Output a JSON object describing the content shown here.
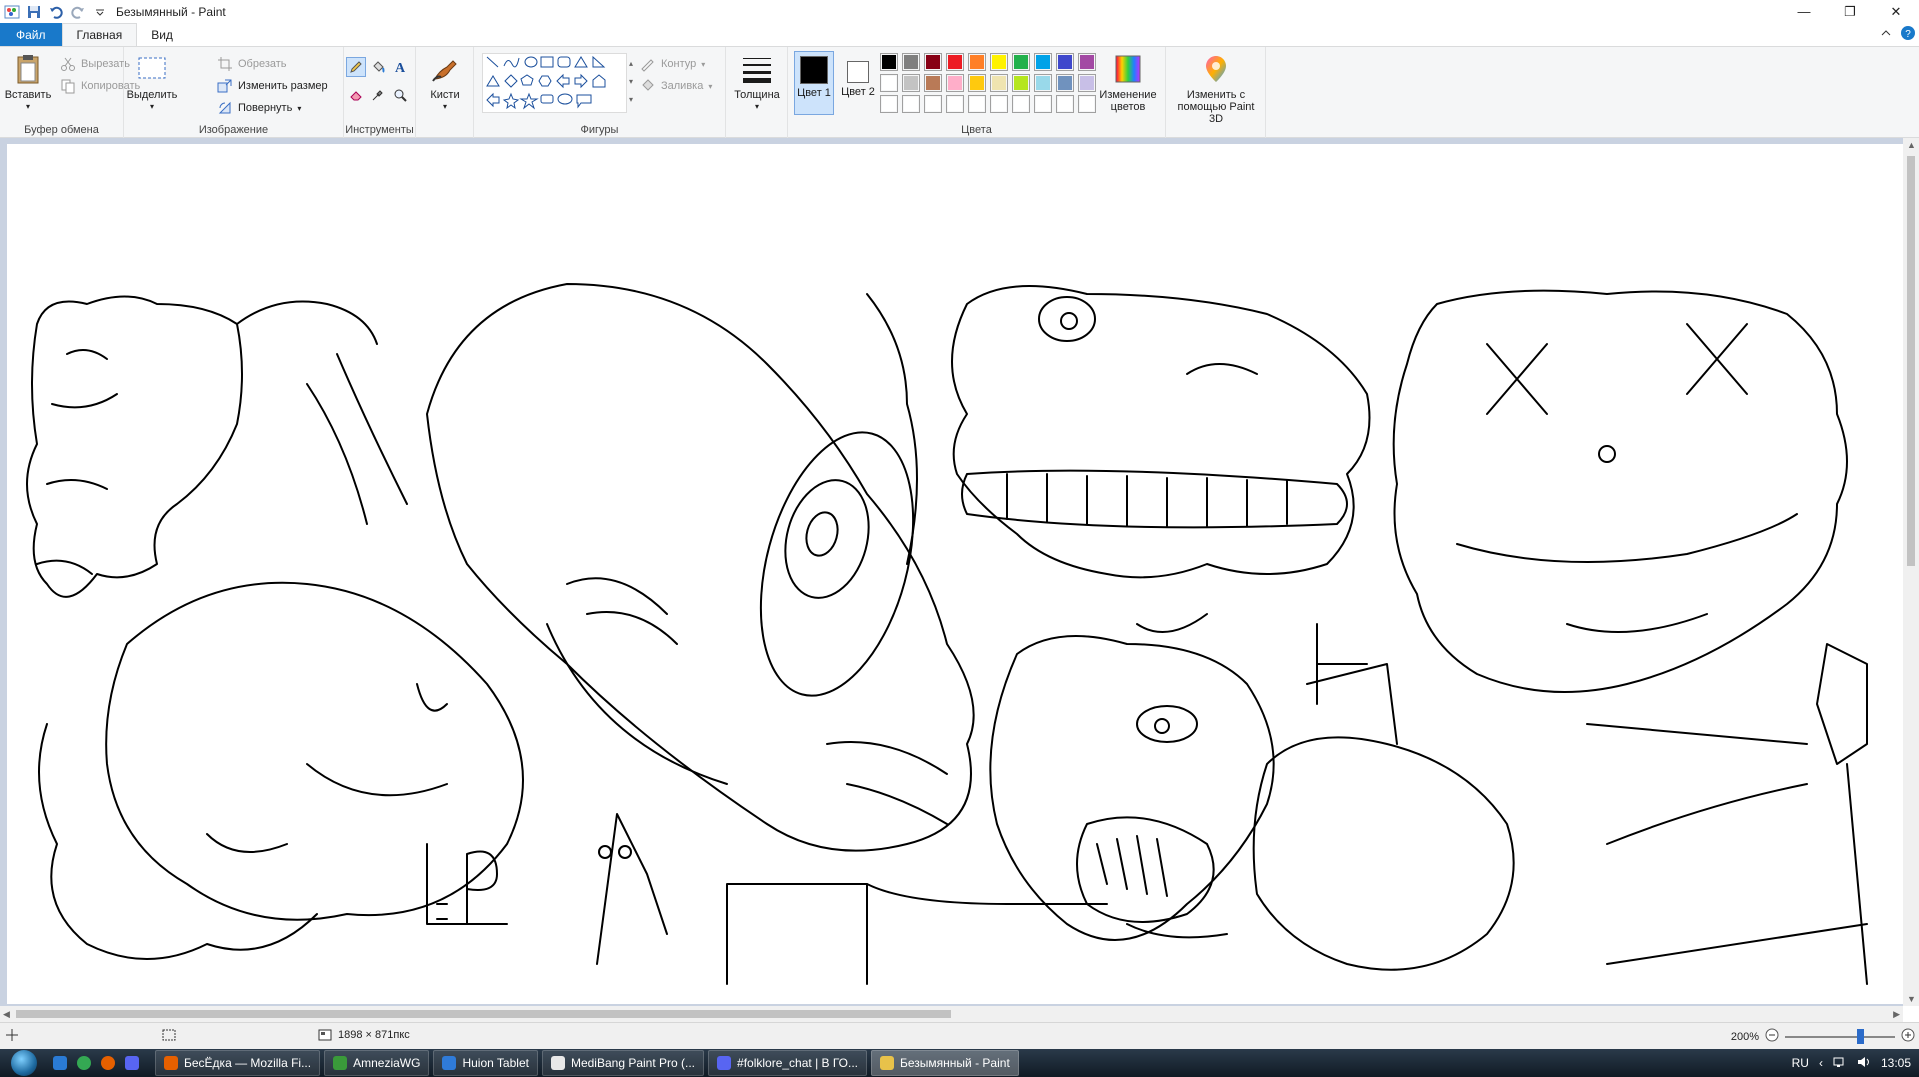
{
  "window": {
    "title": "Безымянный - Paint",
    "controls": {
      "minimize": "—",
      "maximize": "❐",
      "close": "✕"
    }
  },
  "ribbon_tabs": [
    "Файл",
    "Главная",
    "Вид"
  ],
  "clipboard": {
    "paste_label": "Вставить",
    "cut_label": "Вырезать",
    "copy_label": "Копировать",
    "group_label": "Буфер обмена"
  },
  "image": {
    "select_label": "Выделить",
    "crop_label": "Обрезать",
    "resize_label": "Изменить размер",
    "rotate_label": "Повернуть",
    "group_label": "Изображение"
  },
  "tools": {
    "group_label": "Инструменты",
    "brushes_label": "Кисти"
  },
  "shapes": {
    "outline_label": "Контур",
    "fill_label": "Заливка",
    "group_label": "Фигуры"
  },
  "size": {
    "label": "Толщина"
  },
  "colors": {
    "color1_label": "Цвет 1",
    "color2_label": "Цвет 2",
    "color1": "#000000",
    "color2": "#ffffff",
    "palette_row1": [
      "#000000",
      "#7f7f7f",
      "#880015",
      "#ed1c24",
      "#ff7f27",
      "#fff200",
      "#22b14c",
      "#00a2e8",
      "#3f48cc",
      "#a349a4"
    ],
    "palette_row2": [
      "#ffffff",
      "#c3c3c3",
      "#b97a57",
      "#ffaec9",
      "#ffc90e",
      "#efe4b0",
      "#b5e61d",
      "#99d9ea",
      "#7092be",
      "#c8bfe7"
    ],
    "palette_row3": [
      "#ffffff",
      "#ffffff",
      "#ffffff",
      "#ffffff",
      "#ffffff",
      "#ffffff",
      "#ffffff",
      "#ffffff",
      "#ffffff",
      "#ffffff"
    ],
    "edit_colors_label": "Изменение цветов",
    "group_label": "Цвета"
  },
  "paint3d": {
    "label": "Изменить с помощью Paint 3D"
  },
  "status": {
    "image_size": "1898 × 871пкс",
    "zoom": "200%"
  },
  "taskbar": {
    "tasks": [
      {
        "label": "БесЁдка — Mozilla Fi...",
        "color": "#e66000"
      },
      {
        "label": "AmneziaWG",
        "color": "#3a9a3a"
      },
      {
        "label": "Huion Tablet",
        "color": "#2f7bd9"
      },
      {
        "label": "MediBang Paint Pro (...",
        "color": "#e8e8e8"
      },
      {
        "label": "#folklore_chat | В ГО...",
        "color": "#5865f2"
      },
      {
        "label": "Безымянный - Paint",
        "color": "#e8c24a"
      }
    ],
    "language": "RU",
    "time": "13:05"
  }
}
